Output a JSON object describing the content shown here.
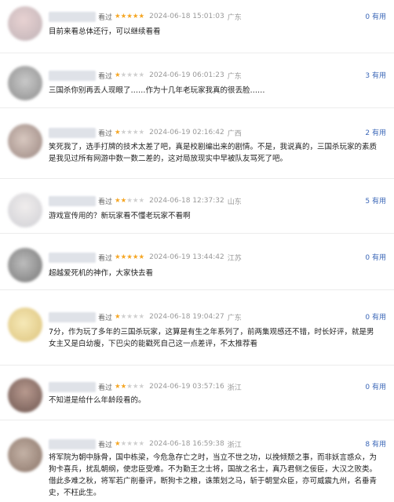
{
  "reviews": [
    {
      "watched": "看过",
      "rating": 5,
      "time": "2024-06-18 15:01:03",
      "location": "广东",
      "useful": "0 有用",
      "text": "目前来看总体还行，可以继续看看"
    },
    {
      "watched": "看过",
      "rating": 1,
      "time": "2024-06-19 06:01:23",
      "location": "广东",
      "useful": "3 有用",
      "text": "三国杀你别再丢人现眼了……作为十几年老玩家我真的很丢脸……"
    },
    {
      "watched": "看过",
      "rating": 1,
      "time": "2024-06-19 02:16:42",
      "location": "广西",
      "useful": "2 有用",
      "text": "笑死我了，选手打牌的技术太差了吧，真是校剧编出来的剧情。不是，我说真的，三国杀玩家的素质是我见过所有网游中数一数二差的，这对局放现实中早被队友骂死了吧。"
    },
    {
      "watched": "看过",
      "rating": 2,
      "time": "2024-06-18 12:37:32",
      "location": "山东",
      "useful": "5 有用",
      "text": "游戏宣传用的？新玩家看不懂老玩家不看啊"
    },
    {
      "watched": "看过",
      "rating": 5,
      "time": "2024-06-19 13:44:42",
      "location": "江苏",
      "useful": "0 有用",
      "text": "超越爱死机的神作，大家快去看"
    },
    {
      "watched": "看过",
      "rating": 1,
      "time": "2024-06-18 19:04:27",
      "location": "广东",
      "useful": "0 有用",
      "text": "7分，作为玩了多年的三国杀玩家，这算是有生之年系列了，前两集观感还不错，时长好评，就是男女主又是白幼瘦，下巴尖的能戳死自己这一点差评，不太推荐看"
    },
    {
      "watched": "看过",
      "rating": 2,
      "time": "2024-06-19 03:57:16",
      "location": "浙江",
      "useful": "0 有用",
      "text": "不知道是给什么年龄段看的。"
    },
    {
      "watched": "看过",
      "rating": 1,
      "time": "2024-06-18 16:59:38",
      "location": "浙江",
      "useful": "8 有用",
      "text": "将军院为朝中脉骨，国中栋梁，今危急存亡之时，当立不世之功，以挽倾颓之事，而非妖言惑众，为狗卡喜兵，扰乱朝纲，使忠臣受难。不为勤王之士将，国故之名士，真乃君侧之佞臣，大汉之败类。借此多难之秋，将军若广削垂评，断狗卡之粮，诛策划之马，斩于朝堂众臣，亦可威震九州，名垂青史，不枉此生。"
    }
  ]
}
